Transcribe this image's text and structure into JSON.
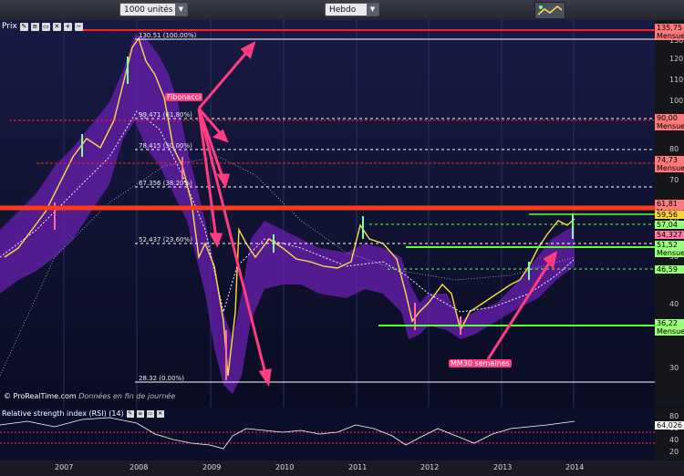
{
  "toolbar": {
    "units": "1000 unités",
    "period": "Hebdo"
  },
  "main_title": "Prix",
  "watermark": {
    "brand": "© ProRealTime.com",
    "note": "Données en fin de journée"
  },
  "rsi_title": "Relative strength index (RSI) (14)",
  "rsi_value": "64,026",
  "annotations": {
    "fibonacci": "Fibonacci",
    "mm30": "MM30 semaines"
  },
  "fib_levels": [
    "130.51 (100.00%)",
    "99.471 (61.80%)",
    "78.415 (50.00%)",
    "67.356 (38.20%)",
    "52.437 (23.60%)",
    "28.32 (0.00%)"
  ],
  "y_axis_ticks": [
    "130",
    "120",
    "110",
    "100",
    "90",
    "80",
    "70",
    "60",
    "50",
    "40",
    "30"
  ],
  "rsi_ticks": [
    "80",
    "60",
    "40",
    "20"
  ],
  "price_tags": [
    {
      "value": "135,75",
      "sub": "Mensuel",
      "color": "#ff7a7a"
    },
    {
      "value": "90,00",
      "sub": "Mensuel",
      "color": "#ff7a7a"
    },
    {
      "value": "74,73",
      "sub": "Mensuel",
      "color": "#ff7a7a"
    },
    {
      "value": "61,81",
      "sub": "Mensuel",
      "color": "#ff7a7a"
    },
    {
      "value": "59,56",
      "sub": "",
      "color": "#ffd23a"
    },
    {
      "value": "57,04",
      "sub": "",
      "color": "#9aff7a"
    },
    {
      "value": "54,327",
      "sub": "",
      "color": "#ff7aa8"
    },
    {
      "value": "51,52",
      "sub": "Mensuel",
      "color": "#9aff7a"
    },
    {
      "value": "46,59",
      "sub": "",
      "color": "#9aff7a"
    },
    {
      "value": "36,22",
      "sub": "Mensuel",
      "color": "#9aff7a"
    }
  ],
  "x_axis": [
    "2007",
    "2008",
    "2009",
    "2010",
    "2011",
    "2012",
    "2013",
    "2014"
  ],
  "chart_data": {
    "type": "candlestick",
    "x": [
      2006.5,
      2007.0,
      2007.3,
      2007.6,
      2007.9,
      2008.0,
      2008.2,
      2008.4,
      2008.6,
      2008.8,
      2009.0,
      2009.1,
      2009.2,
      2009.35,
      2009.5,
      2009.7,
      2010.0,
      2010.3,
      2010.6,
      2010.9,
      2011.1,
      2011.3,
      2011.5,
      2011.7,
      2011.9,
      2012.1,
      2012.3,
      2012.5,
      2012.7,
      2012.9,
      2013.1,
      2013.3,
      2013.5,
      2013.7,
      2013.9
    ],
    "close": [
      52,
      60,
      70,
      82,
      100,
      125,
      118,
      95,
      82,
      68,
      45,
      30,
      38,
      55,
      60,
      56,
      55,
      54,
      53,
      52,
      57,
      55,
      52,
      38,
      44,
      48,
      46,
      38,
      42,
      43,
      44,
      48,
      52,
      56,
      58
    ],
    "ylim": [
      25,
      140
    ],
    "y_scale": "log",
    "rsi": [
      55,
      60,
      65,
      70,
      75,
      72,
      55,
      40,
      35,
      30,
      25,
      38,
      55,
      60,
      52,
      48,
      50,
      49,
      52,
      48,
      58,
      52,
      40,
      30,
      45,
      55,
      45,
      35,
      50,
      52,
      55,
      60,
      62,
      63,
      64
    ]
  }
}
